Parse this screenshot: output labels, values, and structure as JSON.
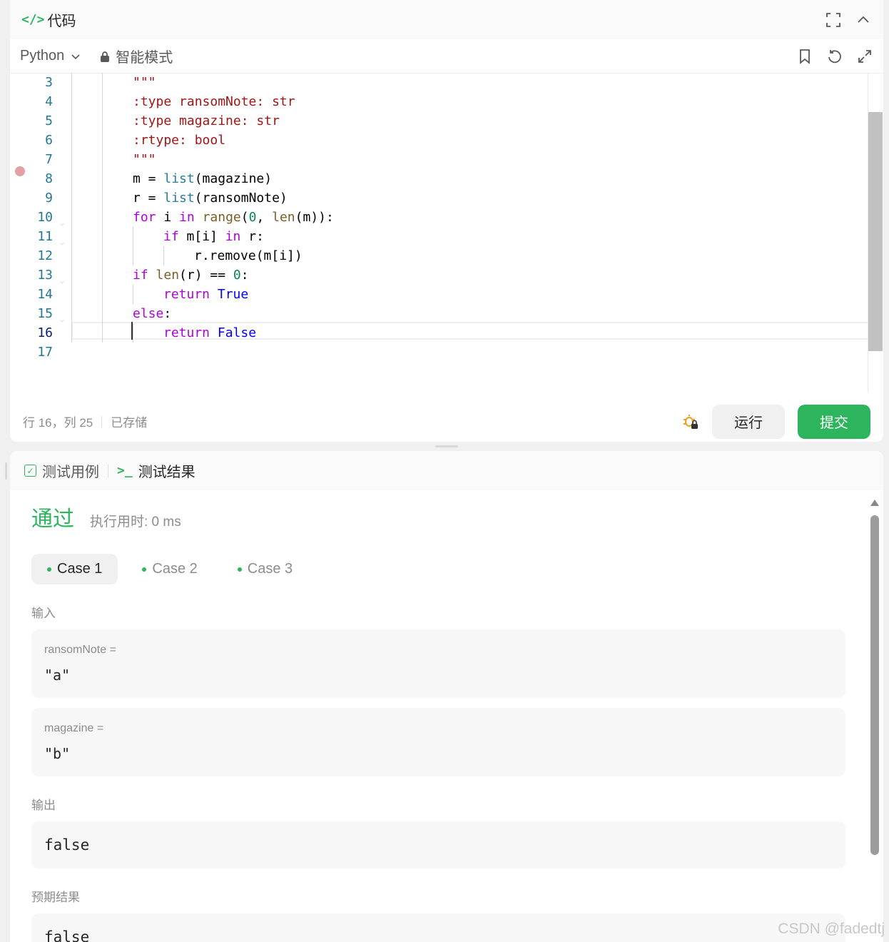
{
  "header": {
    "title": "代码"
  },
  "toolbar": {
    "language": "Python",
    "mode": "智能模式"
  },
  "editor": {
    "lines": [
      {
        "n": "3",
        "indent": 2,
        "tokens": [
          [
            "str",
            "\"\"\""
          ]
        ]
      },
      {
        "n": "4",
        "indent": 2,
        "tokens": [
          [
            "str",
            ":type ransomNote: str"
          ]
        ]
      },
      {
        "n": "5",
        "indent": 2,
        "tokens": [
          [
            "str",
            ":type magazine: str"
          ]
        ]
      },
      {
        "n": "6",
        "indent": 2,
        "tokens": [
          [
            "str",
            ":rtype: bool"
          ]
        ]
      },
      {
        "n": "7",
        "indent": 2,
        "tokens": [
          [
            "str",
            "\"\"\""
          ]
        ]
      },
      {
        "n": "8",
        "indent": 2,
        "tokens": [
          [
            "",
            "m = "
          ],
          [
            "bi",
            "list"
          ],
          [
            "",
            "(magazine)"
          ]
        ]
      },
      {
        "n": "9",
        "indent": 2,
        "tokens": [
          [
            "",
            "r = "
          ],
          [
            "bi",
            "list"
          ],
          [
            "",
            "(ransomNote)"
          ]
        ]
      },
      {
        "n": "10",
        "indent": 2,
        "fold": true,
        "tokens": [
          [
            "kw",
            "for"
          ],
          [
            "",
            " i "
          ],
          [
            "kw",
            "in"
          ],
          [
            "",
            " "
          ],
          [
            "fn",
            "range"
          ],
          [
            "",
            "("
          ],
          [
            "num",
            "0"
          ],
          [
            "",
            ", "
          ],
          [
            "fn",
            "len"
          ],
          [
            "",
            "(m)):"
          ]
        ]
      },
      {
        "n": "11",
        "indent": 3,
        "fold": true,
        "tokens": [
          [
            "kw",
            "if"
          ],
          [
            "",
            " m[i] "
          ],
          [
            "kw",
            "in"
          ],
          [
            "",
            " r:"
          ]
        ]
      },
      {
        "n": "12",
        "indent": 4,
        "tokens": [
          [
            "",
            "r.remove(m[i])"
          ]
        ]
      },
      {
        "n": "13",
        "indent": 2,
        "fold": true,
        "tokens": [
          [
            "kw",
            "if"
          ],
          [
            "",
            " "
          ],
          [
            "fn",
            "len"
          ],
          [
            "",
            "(r) == "
          ],
          [
            "num",
            "0"
          ],
          [
            "",
            ":"
          ]
        ]
      },
      {
        "n": "14",
        "indent": 3,
        "tokens": [
          [
            "kw",
            "return"
          ],
          [
            "",
            " "
          ],
          [
            "bool",
            "True"
          ]
        ]
      },
      {
        "n": "15",
        "indent": 2,
        "fold": true,
        "tokens": [
          [
            "kw",
            "else"
          ],
          [
            "",
            ":"
          ]
        ]
      },
      {
        "n": "16",
        "indent": 3,
        "current": true,
        "tokens": [
          [
            "kw",
            "return"
          ],
          [
            "",
            " "
          ],
          [
            "bool",
            "False"
          ]
        ]
      },
      {
        "n": "17",
        "indent": 0,
        "tokens": []
      }
    ]
  },
  "status": {
    "position": "行 16，列 25",
    "saved": "已存储",
    "run_label": "运行",
    "submit_label": "提交"
  },
  "result": {
    "tabs": [
      "测试用例",
      "测试结果"
    ],
    "verdict": "通过",
    "runtime": "执行用时: 0 ms",
    "cases": [
      "Case 1",
      "Case 2",
      "Case 3"
    ],
    "input_label": "输入",
    "inputs": [
      {
        "name": "ransomNote =",
        "value": "\"a\""
      },
      {
        "name": "magazine =",
        "value": "\"b\""
      }
    ],
    "output_label": "输出",
    "output": "false",
    "expected_label": "预期结果",
    "expected": "false"
  },
  "watermark": "CSDN @fadedtj",
  "colors": {
    "accent": "#2db55d"
  }
}
